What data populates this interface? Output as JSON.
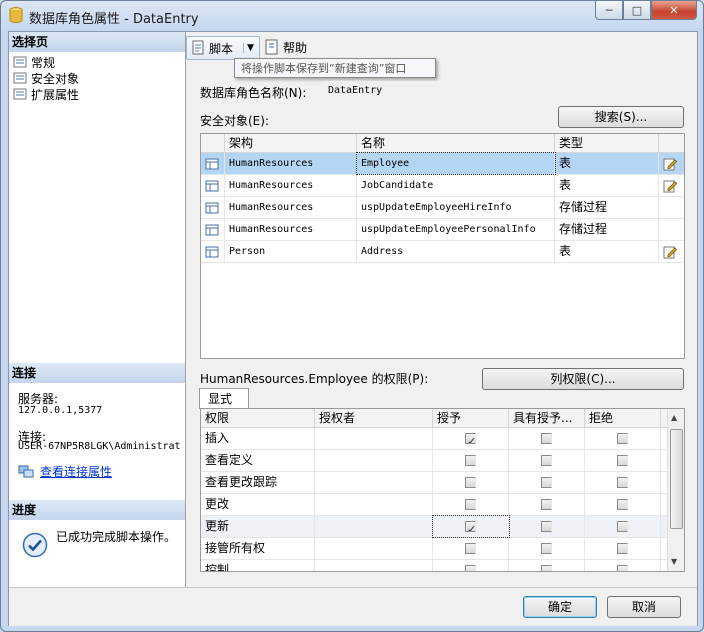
{
  "window": {
    "title": "数据库角色属性 - DataEntry",
    "controls": [
      "─",
      "□",
      "✕"
    ]
  },
  "left_panel": {
    "select_page": {
      "heading": "选择页",
      "items": [
        {
          "label": "常规"
        },
        {
          "label": "安全对象"
        },
        {
          "label": "扩展属性"
        }
      ]
    },
    "connection": {
      "heading": "连接",
      "server_label": "服务器:",
      "server_value": "127.0.0.1,5377",
      "conn_label": "连接:",
      "conn_value": "USER-67NP5R8LGK\\Administrat",
      "view_link": "查看连接属性"
    },
    "progress": {
      "heading": "进度",
      "status": "已成功完成脚本操作。"
    }
  },
  "toolbar": {
    "script_label": "脚本",
    "help_label": "帮助",
    "tooltip": "将操作脚本保存到“新建查询”窗口"
  },
  "role_name": {
    "label": "数据库角色名称(N):",
    "value": "DataEntry"
  },
  "securables": {
    "label": "安全对象(E):",
    "search_button": "搜索(S)...",
    "columns": [
      "架构",
      "名称",
      "类型"
    ],
    "rows": [
      {
        "schema": "HumanResources",
        "name": "Employee",
        "type": "表",
        "selected": true
      },
      {
        "schema": "HumanResources",
        "name": "JobCandidate",
        "type": "表",
        "selected": false
      },
      {
        "schema": "HumanResources",
        "name": "uspUpdateEmployeeHireInfo",
        "type": "存储过程",
        "selected": false
      },
      {
        "schema": "HumanResources",
        "name": "uspUpdateEmployeePersonalInfo",
        "type": "存储过程",
        "selected": false
      },
      {
        "schema": "Person",
        "name": "Address",
        "type": "表",
        "selected": false
      }
    ]
  },
  "permissions": {
    "label": "HumanResources.Employee 的权限(P):",
    "column_perm_button": "列权限(C)...",
    "tab": "显式",
    "columns": [
      "权限",
      "授权者",
      "授予",
      "具有授予...",
      "拒绝"
    ],
    "rows": [
      {
        "perm": "插入",
        "grantor": "",
        "grant": true,
        "with_grant": false,
        "deny": false
      },
      {
        "perm": "查看定义",
        "grantor": "",
        "grant": false,
        "with_grant": false,
        "deny": false
      },
      {
        "perm": "查看更改跟踪",
        "grantor": "",
        "grant": false,
        "with_grant": false,
        "deny": false
      },
      {
        "perm": "更改",
        "grantor": "",
        "grant": false,
        "with_grant": false,
        "deny": false
      },
      {
        "perm": "更新",
        "grantor": "",
        "grant": true,
        "with_grant": false,
        "deny": false
      },
      {
        "perm": "接管所有权",
        "grantor": "",
        "grant": false,
        "with_grant": false,
        "deny": false
      },
      {
        "perm": "控制",
        "grantor": "",
        "grant": false,
        "with_grant": false,
        "deny": false
      }
    ]
  },
  "footer": {
    "ok": "确定",
    "cancel": "取消"
  }
}
